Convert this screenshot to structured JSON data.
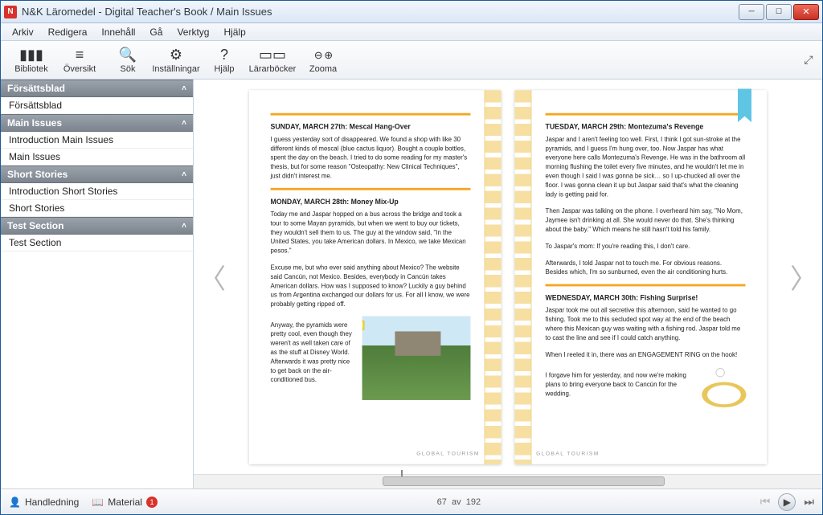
{
  "window": {
    "title": "N&K Läromedel - Digital Teacher's Book / Main Issues"
  },
  "menu": {
    "items": [
      "Arkiv",
      "Redigera",
      "Innehåll",
      "Gå",
      "Verktyg",
      "Hjälp"
    ]
  },
  "toolbar": {
    "bibliotek": "Bibliotek",
    "oversikt": "Översikt",
    "sok": "Sök",
    "installningar": "Inställningar",
    "hjalp": "Hjälp",
    "lararbocker": "Lärarböcker",
    "zooma": "Zooma",
    "zoom_glyphs": "⊖ ⊕"
  },
  "sidebar": {
    "sections": [
      {
        "header": "Försättsblad",
        "items": [
          "Försättsblad"
        ]
      },
      {
        "header": "Main Issues",
        "items": [
          "Introduction Main Issues",
          "Main Issues"
        ]
      },
      {
        "header": "Short Stories",
        "items": [
          "Introduction Short Stories",
          "Short Stories"
        ]
      },
      {
        "header": "Test Section",
        "items": [
          "Test Section"
        ]
      }
    ]
  },
  "book": {
    "footer_tag": "GLOBAL TOURISM",
    "left": {
      "e1_h": "SUNDAY, MARCH 27th:  Mescal Hang-Over",
      "e1_p": "I guess yesterday sort of disappeared. We found a shop with like 30 different kinds of mescal (blue cactus liquor). Bought a couple bottles, spent the day on the beach. I tried to do some reading for my master's thesis, but for some reason \"Osteopathy: New Clinical Techniques\", just didn't interest me.",
      "e2_h": "MONDAY, MARCH 28th:  Money Mix-Up",
      "e2_p1": "Today me and Jaspar hopped on a bus across the bridge and took a tour to some Mayan pyramids, but when we went to buy our tickets, they wouldn't sell them to us. The guy at the window said, \"In the United States, you take American dollars. In Mexico, we take Mexican pesos.\"",
      "e2_p2": "Excuse me, but who ever said anything about Mexico? The website said Cancún, not Mexico. Besides, everybody in Cancún takes American dollars. How was I supposed to know? Luckily a guy behind us from Argentina exchanged our dollars for us. For all I know, we were probably getting ripped off.",
      "e2_p3": "Anyway, the pyramids were pretty cool, even though they weren't as well taken care of as the stuff at Disney World. Afterwards it was pretty nice to get back on the air-conditioned bus."
    },
    "right": {
      "e1_h": "TUESDAY, MARCH 29th:  Montezuma's Revenge",
      "e1_p1": "Jaspar and I aren't feeling too well. First, I think I got sun-stroke at the pyramids, and I guess I'm hung over, too. Now Jaspar has what everyone here calls Montezuma's Revenge. He was in the bathroom all morning flushing the toilet every five minutes, and he wouldn't let me in even though I said I was gonna be sick… so I up-chucked all over the floor. I was gonna clean it up but Jaspar said that's what the cleaning lady is getting paid for.",
      "e1_p2": "Then Jaspar was talking on the phone. I overheard him say, \"No Mom, Jaymee isn't drinking at all. She would never do that. She's thinking about the baby.\" Which means he still hasn't told his family.",
      "e1_p3": "To Jaspar's mom: If you're reading this, I don't care.",
      "e1_p4": "Afterwards, I told Jaspar not to touch me. For obvious reasons. Besides which, I'm so sunburned, even the air conditioning hurts.",
      "e2_h": "WEDNESDAY, MARCH 30th:  Fishing Surprise!",
      "e2_p1": "Jaspar took me out all secretive this afternoon, said he wanted to go fishing. Took me to this secluded spot way at the end of the beach where this Mexican guy was waiting with a fishing rod. Jaspar told me to cast the line and see if I could catch anything.",
      "e2_p2": "When I reeled it in, there was an ENGAGEMENT RING on the hook!",
      "e2_p3": "I forgave him for yesterday, and now we're making plans to bring everyone back to Cancún for the wedding."
    }
  },
  "status": {
    "handledning": "Handledning",
    "material": "Material",
    "material_badge": "1",
    "current_page": "67",
    "sep": "av",
    "total_pages": "192"
  }
}
